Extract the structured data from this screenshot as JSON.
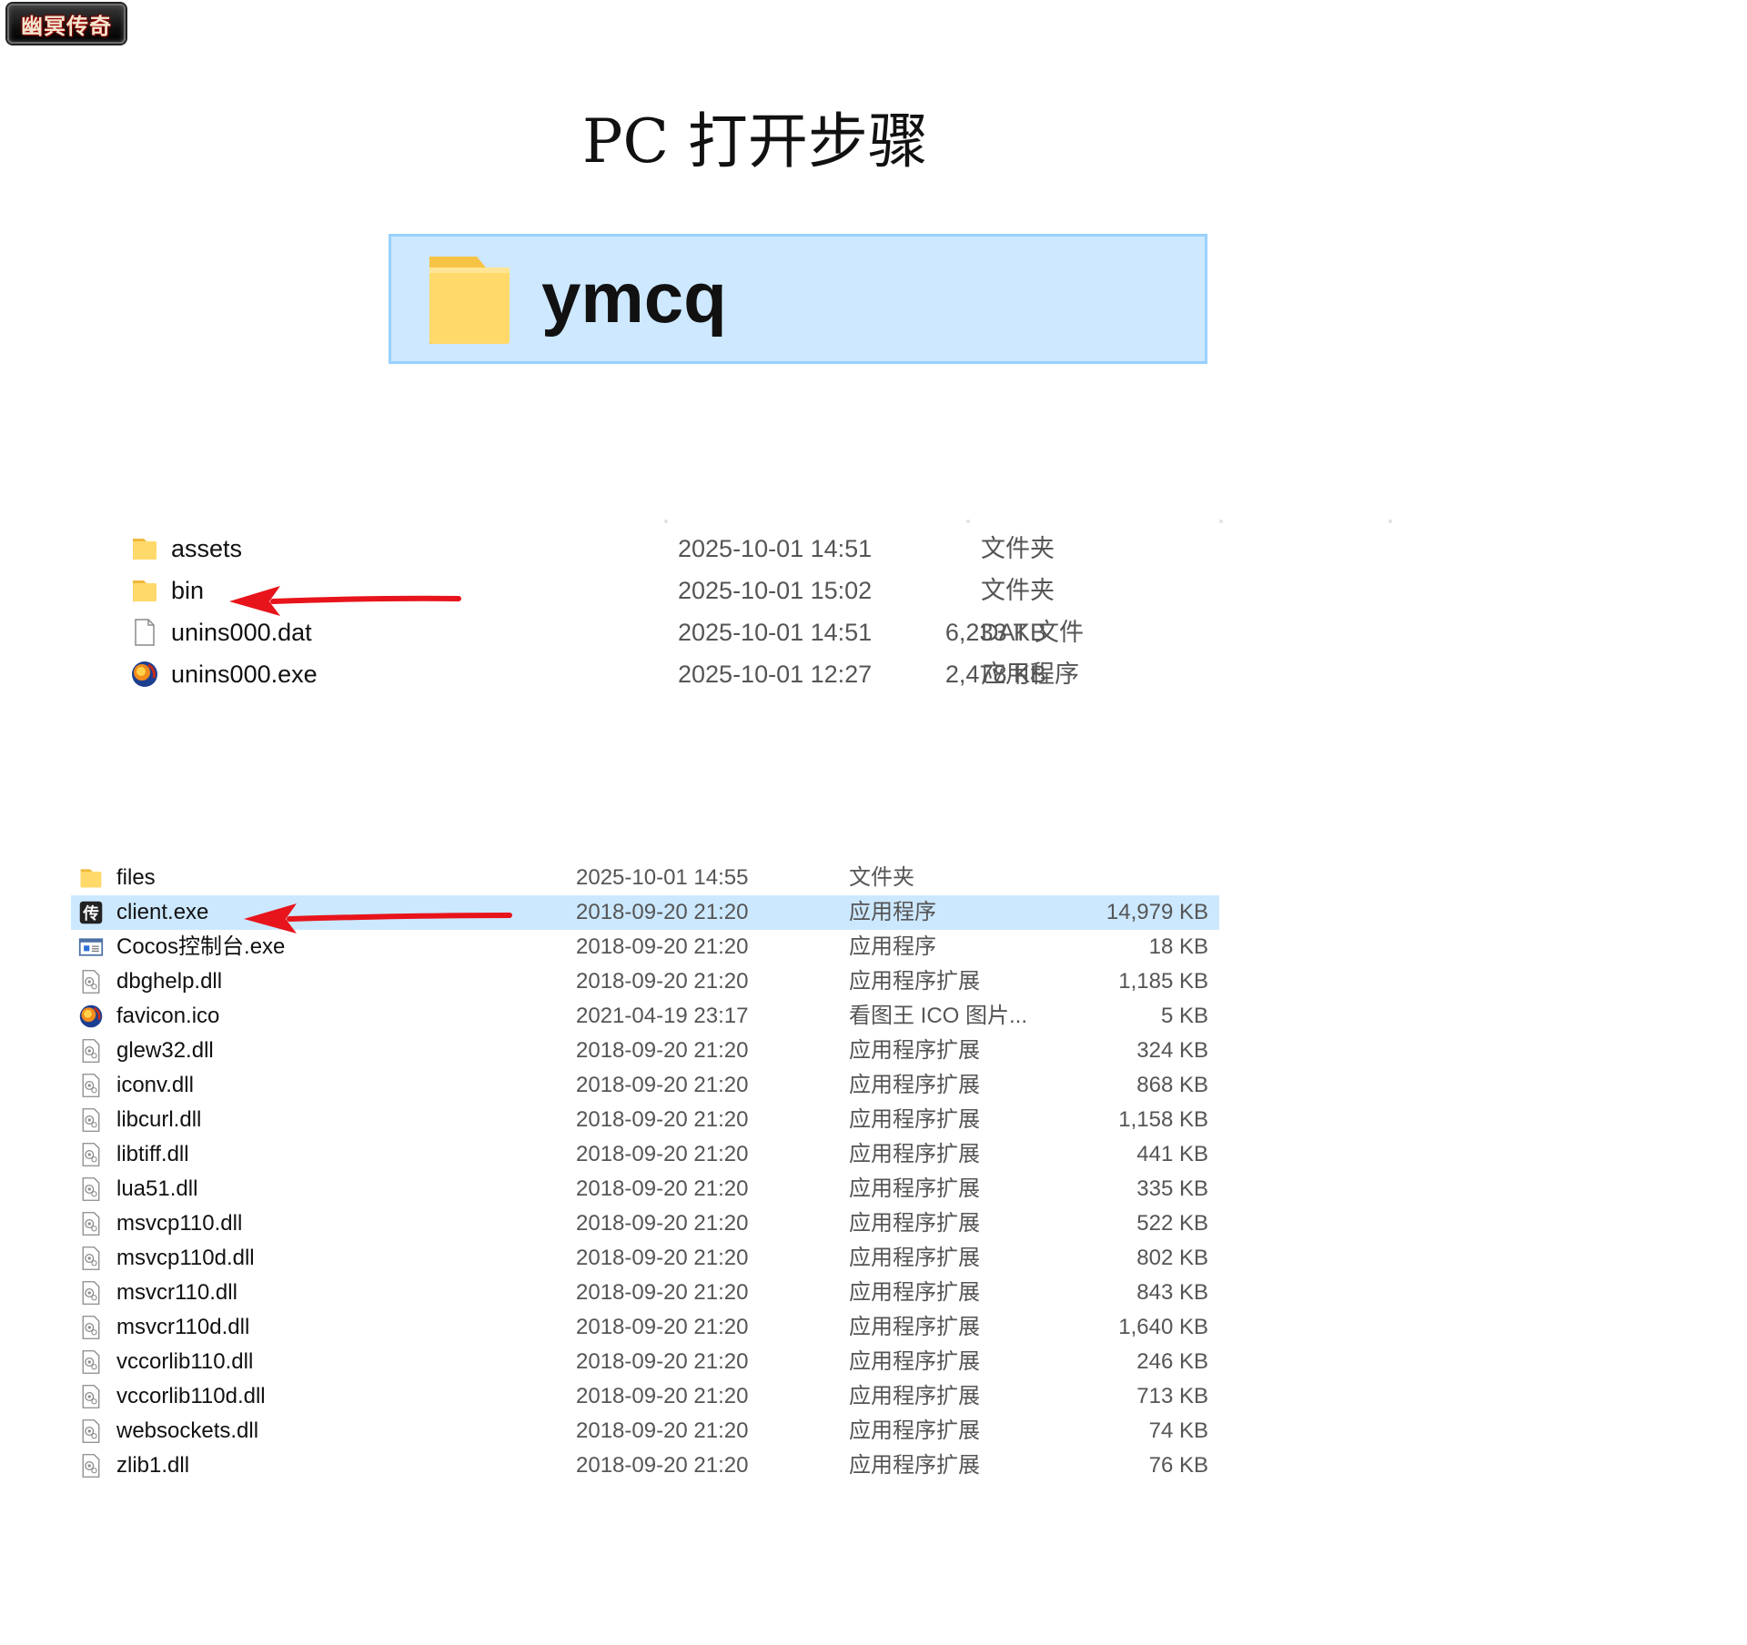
{
  "logo": {
    "text": "幽冥传奇"
  },
  "page_title": "PC 打开步骤",
  "banner": {
    "folder_name": "ymcq",
    "icon": "folder-icon"
  },
  "list_a": {
    "items": [
      {
        "name": "assets",
        "date": "2025-10-01 14:51",
        "type": "文件夹",
        "size": "",
        "icon": "folder-icon"
      },
      {
        "name": "bin",
        "date": "2025-10-01 15:02",
        "type": "文件夹",
        "size": "",
        "icon": "folder-icon"
      },
      {
        "name": "unins000.dat",
        "date": "2025-10-01 14:51",
        "type": "DAT 文件",
        "size": "6,233 KB",
        "icon": "file-icon"
      },
      {
        "name": "unins000.exe",
        "date": "2025-10-01 12:27",
        "type": "应用程序",
        "size": "2,478 KB",
        "icon": "app-icon"
      }
    ]
  },
  "list_b": {
    "items": [
      {
        "name": "files",
        "date": "2025-10-01 14:55",
        "type": "文件夹",
        "size": "",
        "icon": "folder-icon"
      },
      {
        "name": "client.exe",
        "date": "2018-09-20 21:20",
        "type": "应用程序",
        "size": "14,979 KB",
        "icon": "client-app-icon"
      },
      {
        "name": "Cocos控制台.exe",
        "date": "2018-09-20 21:20",
        "type": "应用程序",
        "size": "18 KB",
        "icon": "console-window-icon"
      },
      {
        "name": "dbghelp.dll",
        "date": "2018-09-20 21:20",
        "type": "应用程序扩展",
        "size": "1,185 KB",
        "icon": "dll-icon"
      },
      {
        "name": "favicon.ico",
        "date": "2021-04-19 23:17",
        "type": "看图王 ICO 图片...",
        "size": "5 KB",
        "icon": "app-icon"
      },
      {
        "name": "glew32.dll",
        "date": "2018-09-20 21:20",
        "type": "应用程序扩展",
        "size": "324 KB",
        "icon": "dll-icon"
      },
      {
        "name": "iconv.dll",
        "date": "2018-09-20 21:20",
        "type": "应用程序扩展",
        "size": "868 KB",
        "icon": "dll-icon"
      },
      {
        "name": "libcurl.dll",
        "date": "2018-09-20 21:20",
        "type": "应用程序扩展",
        "size": "1,158 KB",
        "icon": "dll-icon"
      },
      {
        "name": "libtiff.dll",
        "date": "2018-09-20 21:20",
        "type": "应用程序扩展",
        "size": "441 KB",
        "icon": "dll-icon"
      },
      {
        "name": "lua51.dll",
        "date": "2018-09-20 21:20",
        "type": "应用程序扩展",
        "size": "335 KB",
        "icon": "dll-icon"
      },
      {
        "name": "msvcp110.dll",
        "date": "2018-09-20 21:20",
        "type": "应用程序扩展",
        "size": "522 KB",
        "icon": "dll-icon"
      },
      {
        "name": "msvcp110d.dll",
        "date": "2018-09-20 21:20",
        "type": "应用程序扩展",
        "size": "802 KB",
        "icon": "dll-icon"
      },
      {
        "name": "msvcr110.dll",
        "date": "2018-09-20 21:20",
        "type": "应用程序扩展",
        "size": "843 KB",
        "icon": "dll-icon"
      },
      {
        "name": "msvcr110d.dll",
        "date": "2018-09-20 21:20",
        "type": "应用程序扩展",
        "size": "1,640 KB",
        "icon": "dll-icon"
      },
      {
        "name": "vccorlib110.dll",
        "date": "2018-09-20 21:20",
        "type": "应用程序扩展",
        "size": "246 KB",
        "icon": "dll-icon"
      },
      {
        "name": "vccorlib110d.dll",
        "date": "2018-09-20 21:20",
        "type": "应用程序扩展",
        "size": "713 KB",
        "icon": "dll-icon"
      },
      {
        "name": "websockets.dll",
        "date": "2018-09-20 21:20",
        "type": "应用程序扩展",
        "size": "74 KB",
        "icon": "dll-icon"
      },
      {
        "name": "zlib1.dll",
        "date": "2018-09-20 21:20",
        "type": "应用程序扩展",
        "size": "76 KB",
        "icon": "dll-icon"
      }
    ]
  },
  "annotations": {
    "arrow_1_target": "bin",
    "arrow_2_target": "client.exe",
    "arrow_color": "#e8141b"
  },
  "colors": {
    "selection": "#cce8ff",
    "banner_bg": "#cde8ff",
    "folder": "#ffd96a"
  }
}
